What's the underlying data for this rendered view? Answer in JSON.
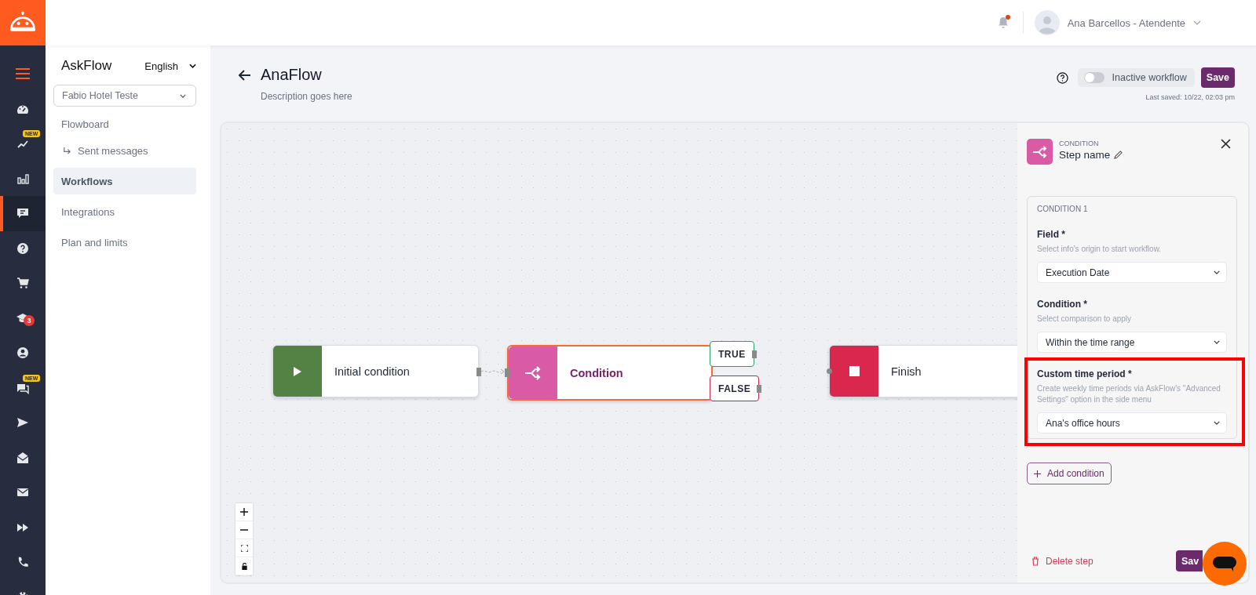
{
  "top_bar": {
    "notification": true,
    "user_name": "Ana Barcellos - Atendente"
  },
  "rail": {
    "items": [
      {
        "selected": false
      },
      {
        "selected": false,
        "badge": {
          "text": "NEW",
          "kind": "new"
        }
      },
      {
        "selected": false
      },
      {
        "selected": true
      },
      {
        "selected": false
      },
      {
        "selected": false
      },
      {
        "selected": false,
        "badge": {
          "text": "3",
          "kind": "count"
        }
      },
      {
        "selected": false
      },
      {
        "selected": false,
        "badge": {
          "text": "NEW",
          "kind": "new"
        }
      },
      {
        "selected": false
      },
      {
        "selected": false
      },
      {
        "selected": false
      },
      {
        "selected": false
      },
      {
        "selected": false
      },
      {
        "selected": false
      }
    ]
  },
  "sidebar": {
    "app_name": "AskFlow",
    "language": "English",
    "account": "Fabio Hotel Teste",
    "items": [
      {
        "label": "Flowboard",
        "selected": false,
        "children": [
          {
            "label": "Sent messages",
            "selected": false
          }
        ]
      },
      {
        "label": "Workflows",
        "selected": true
      },
      {
        "label": "Integrations",
        "selected": false
      },
      {
        "label": "Plan and limits",
        "selected": false
      }
    ]
  },
  "header": {
    "title": "AnaFlow",
    "description": "Description goes here",
    "toggle": {
      "label": "Inactive workflow",
      "on": false
    },
    "save": "Save",
    "last_saved": "Last saved: 10/22, 02:03 pm"
  },
  "nodes": [
    {
      "kind": "start",
      "label": "Initial condition",
      "selected": false
    },
    {
      "kind": "condition",
      "label": "Condition",
      "selected": true,
      "outputs": [
        {
          "label": "TRUE",
          "kind": "true"
        },
        {
          "label": "FALSE",
          "kind": "false"
        }
      ]
    },
    {
      "kind": "finish",
      "label": "Finish",
      "selected": false
    }
  ],
  "panel": {
    "type_label": "CONDITION",
    "step_name": "Step name",
    "conditions": [
      {
        "title": "CONDITION 1",
        "fields": [
          {
            "label": "Field *",
            "hint": "Select info's origin to start workflow.",
            "value": "Execution Date",
            "highlighted": false
          },
          {
            "label": "Condition *",
            "hint": "Select comparison to apply",
            "value": "Within the time range",
            "highlighted": false
          },
          {
            "label": "Custom time period *",
            "hint": "Create weekly time periods via AskFlow's \"Advanced Settings\" option in the side menu",
            "value": "Ana's office hours",
            "highlighted": true
          }
        ]
      }
    ],
    "add_button": "Add condition",
    "delete_button": "Delete step",
    "save_button": "Sav"
  }
}
